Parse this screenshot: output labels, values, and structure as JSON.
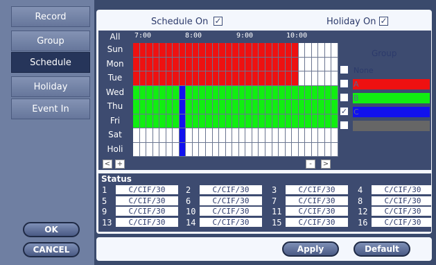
{
  "sidebar": {
    "items": [
      {
        "label": "Record",
        "active": false
      },
      {
        "label": "Group",
        "active": false
      },
      {
        "label": "Schedule",
        "active": true
      },
      {
        "label": "Holiday",
        "active": false
      },
      {
        "label": "Event In",
        "active": false
      }
    ],
    "ok_label": "OK",
    "cancel_label": "CANCEL"
  },
  "header": {
    "schedule_on_label": "Schedule On",
    "schedule_on_checked": true,
    "holiday_on_label": "Holiday On",
    "holiday_on_checked": true
  },
  "schedule": {
    "corner_label": "All",
    "time_labels": [
      "7:00",
      "8:00",
      "9:00",
      "10:00"
    ],
    "days": [
      "Sun",
      "Mon",
      "Tue",
      "Wed",
      "Thu",
      "Fri",
      "Sat",
      "Holi"
    ],
    "colors": {
      "A": "#ee1111",
      "B": "#11ee11",
      "C": "#1111ee",
      "none": "#ffffff",
      "D": "#666666"
    },
    "rows": [
      "AAAAAAAAAAAAAAAAAAAAAAAAA______",
      "AAAAAAAAAAAAAAAAAAAAAAAAA______",
      "AAAAAAAAAAAAAAAAAAAAAAAAA______",
      "BBBBBBBCBBBBBBBBBBBBBBBBBBBBBBB",
      "BBBBBBBCBBBBBBBBBBBBBBBBBBBBBBB",
      "BBBBBBBCBBBBBBBBBBBBBBBBBBBBBBB",
      "_______C_______________________",
      "_______C_______________________"
    ],
    "blue_col": 7,
    "nav": {
      "prev": "<",
      "zoom_in": "+",
      "zoom_out": "-",
      "next": ">"
    }
  },
  "group": {
    "title": "Group",
    "options": [
      {
        "label": "None",
        "checked": false,
        "color": ""
      },
      {
        "label": "A",
        "checked": false,
        "color": "#ee1111"
      },
      {
        "label": "B",
        "checked": false,
        "color": "#11ee11"
      },
      {
        "label": "C",
        "checked": true,
        "color": "#1111ee"
      },
      {
        "label": "",
        "checked": false,
        "color": "#666666"
      }
    ]
  },
  "status": {
    "title": "Status",
    "channels": [
      {
        "num": "1",
        "value": "C/CIF/30"
      },
      {
        "num": "2",
        "value": "C/CIF/30"
      },
      {
        "num": "3",
        "value": "C/CIF/30"
      },
      {
        "num": "4",
        "value": "C/CIF/30"
      },
      {
        "num": "5",
        "value": "C/CIF/30"
      },
      {
        "num": "6",
        "value": "C/CIF/30"
      },
      {
        "num": "7",
        "value": "C/CIF/30"
      },
      {
        "num": "8",
        "value": "C/CIF/30"
      },
      {
        "num": "9",
        "value": "C/CIF/30"
      },
      {
        "num": "10",
        "value": "C/CIF/30"
      },
      {
        "num": "11",
        "value": "C/CIF/30"
      },
      {
        "num": "12",
        "value": "C/CIF/30"
      },
      {
        "num": "13",
        "value": "C/CIF/30"
      },
      {
        "num": "14",
        "value": "C/CIF/30"
      },
      {
        "num": "15",
        "value": "C/CIF/30"
      },
      {
        "num": "16",
        "value": "C/CIF/30"
      }
    ]
  },
  "footer": {
    "apply_label": "Apply",
    "default_label": "Default"
  }
}
